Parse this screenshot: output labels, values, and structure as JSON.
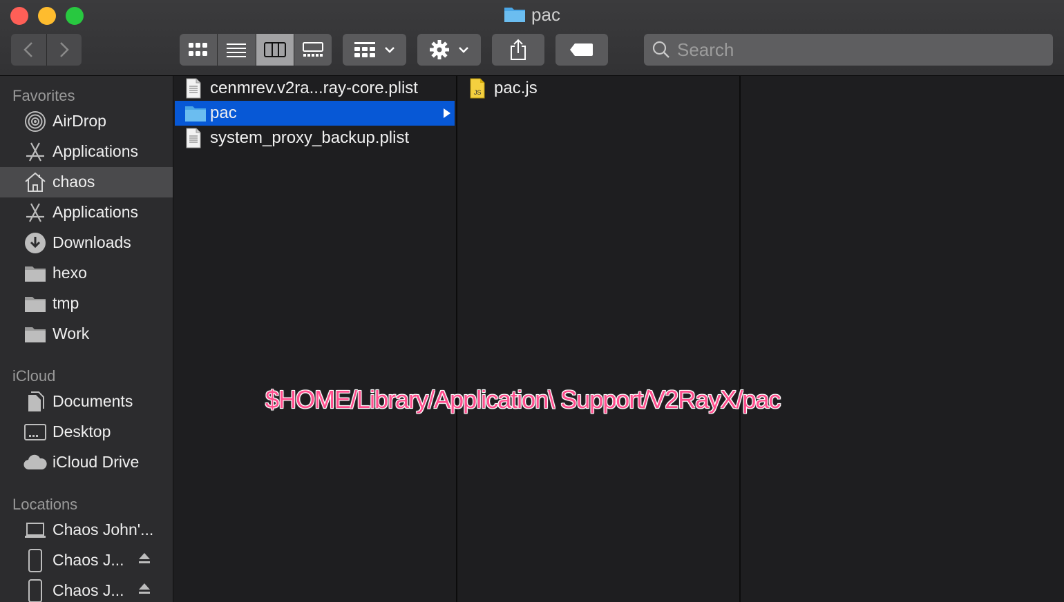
{
  "window": {
    "title": "pac"
  },
  "toolbar": {
    "search_placeholder": "Search",
    "view_modes": [
      "icon",
      "list",
      "column",
      "gallery"
    ],
    "active_view": "column"
  },
  "sidebar": {
    "favorites_header": "Favorites",
    "favorites": [
      {
        "label": "AirDrop",
        "icon": "airdrop-icon"
      },
      {
        "label": "Applications",
        "icon": "applications-icon"
      },
      {
        "label": "chaos",
        "icon": "home-icon",
        "selected": true
      },
      {
        "label": "Applications",
        "icon": "applications-icon"
      },
      {
        "label": "Downloads",
        "icon": "downloads-icon"
      },
      {
        "label": "hexo",
        "icon": "folder-icon"
      },
      {
        "label": "tmp",
        "icon": "folder-icon"
      },
      {
        "label": "Work",
        "icon": "folder-icon"
      }
    ],
    "icloud_header": "iCloud",
    "icloud": [
      {
        "label": "Documents",
        "icon": "documents-icon"
      },
      {
        "label": "Desktop",
        "icon": "desktop-icon"
      },
      {
        "label": "iCloud Drive",
        "icon": "cloud-icon"
      }
    ],
    "locations_header": "Locations",
    "locations": [
      {
        "label": "Chaos John'...",
        "icon": "laptop-icon"
      },
      {
        "label": "Chaos J...",
        "icon": "phone-icon",
        "eject": true
      },
      {
        "label": "Chaos J...",
        "icon": "phone-icon",
        "eject": true
      }
    ]
  },
  "columns": {
    "col1": [
      {
        "label": "cenmrev.v2ra...ray-core.plist",
        "icon": "plist-file-icon"
      },
      {
        "label": "pac",
        "icon": "folder-icon",
        "selected": true
      },
      {
        "label": "system_proxy_backup.plist",
        "icon": "plist-file-icon"
      }
    ],
    "col2": [
      {
        "label": "pac.js",
        "icon": "js-file-icon"
      }
    ]
  },
  "overlay_text": "$HOME/Library/Application\\ Support/V2RayX/pac",
  "colors": {
    "selection": "#0758d6",
    "overlay": "#ff4f8e",
    "sidebar_bg": "#2c2c2e"
  }
}
